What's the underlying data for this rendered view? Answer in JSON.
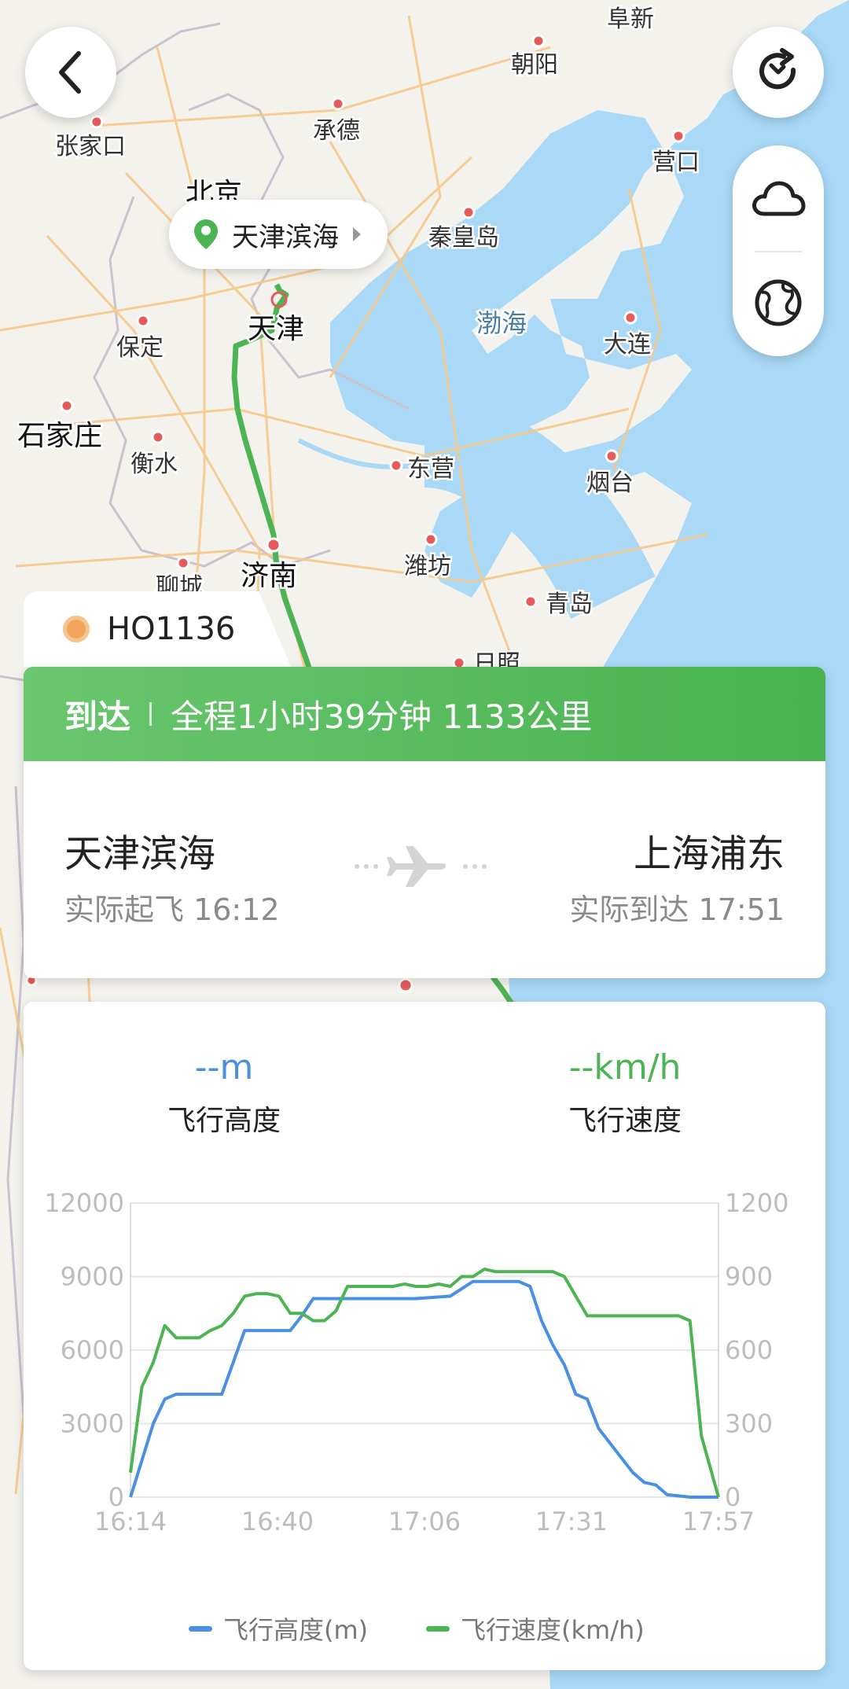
{
  "map": {
    "labels": [
      {
        "name": "阜新",
        "cls": ""
      },
      {
        "name": "朝阳",
        "cls": ""
      },
      {
        "name": "张家口",
        "cls": ""
      },
      {
        "name": "承德",
        "cls": ""
      },
      {
        "name": "营口",
        "cls": ""
      },
      {
        "name": "北京",
        "cls": "big"
      },
      {
        "name": "秦皇岛",
        "cls": ""
      },
      {
        "name": "天津",
        "cls": "big"
      },
      {
        "name": "保定",
        "cls": ""
      },
      {
        "name": "渤海",
        "cls": "sea"
      },
      {
        "name": "大连",
        "cls": ""
      },
      {
        "name": "石家庄",
        "cls": "big"
      },
      {
        "name": "衡水",
        "cls": ""
      },
      {
        "name": "东营",
        "cls": ""
      },
      {
        "name": "烟台",
        "cls": ""
      },
      {
        "name": "济南",
        "cls": "big"
      },
      {
        "name": "潍坊",
        "cls": ""
      },
      {
        "name": "聊城",
        "cls": ""
      },
      {
        "name": "青岛",
        "cls": ""
      },
      {
        "name": "日照",
        "cls": ""
      }
    ],
    "origin_tag": "天津滨海",
    "accent_green": "#4cb453",
    "sea_color": "#a8d8f5"
  },
  "controls": {
    "back_icon": "chevron-left-icon",
    "refresh_icon": "refresh-icon",
    "weather_icon": "cloud-icon",
    "globe_icon": "globe-icon"
  },
  "flight": {
    "number": "HO1136",
    "status": "到达",
    "summary": "全程1小时39分钟 1133公里",
    "origin": {
      "name": "天津滨海",
      "time_label": "实际起飞 16:12"
    },
    "destination": {
      "name": "上海浦东",
      "time_label": "实际到达 17:51"
    }
  },
  "metrics": {
    "altitude_value": "--m",
    "altitude_label": "飞行高度",
    "speed_value": "--km/h",
    "speed_label": "飞行速度",
    "altitude_color": "#4a90e2",
    "speed_color": "#4cb453"
  },
  "legend": {
    "altitude": "飞行高度(m)",
    "speed": "飞行速度(km/h)"
  },
  "chart_data": {
    "type": "line",
    "x_ticks": [
      "16:14",
      "16:40",
      "17:06",
      "17:31",
      "17:57"
    ],
    "y_left": {
      "ticks": [
        "12000",
        "9000",
        "6000",
        "3000",
        "0"
      ],
      "range": [
        0,
        12000
      ]
    },
    "y_right": {
      "ticks": [
        "1200",
        "900",
        "600",
        "300",
        "0"
      ],
      "range": [
        0,
        1200
      ]
    },
    "x_range_minutes": [
      0,
      103
    ],
    "grid": true,
    "legend_position": "bottom",
    "series": [
      {
        "name": "飞行高度(m)",
        "axis": "left",
        "color": "#4a90e2",
        "x": [
          0,
          2,
          4,
          6,
          8,
          10,
          13,
          16,
          20,
          22,
          24,
          26,
          28,
          30,
          32,
          34,
          35,
          37,
          38,
          40,
          42,
          44,
          46,
          50,
          56,
          60,
          62,
          64,
          66,
          68,
          70,
          72,
          74,
          76,
          78,
          80,
          82,
          84,
          86,
          88,
          90,
          92,
          94,
          96,
          98,
          100,
          103
        ],
        "y": [
          0,
          1500,
          3000,
          4000,
          4200,
          4200,
          4200,
          4200,
          6800,
          6800,
          6800,
          6800,
          6800,
          7400,
          8100,
          8100,
          8100,
          8100,
          8100,
          8100,
          8100,
          8100,
          8100,
          8100,
          8200,
          8800,
          8800,
          8800,
          8800,
          8800,
          8600,
          7200,
          6200,
          5400,
          4200,
          4000,
          2800,
          2200,
          1600,
          1000,
          600,
          500,
          100,
          50,
          0,
          0,
          0
        ]
      },
      {
        "name": "飞行速度(km/h)",
        "axis": "right",
        "color": "#4cb453",
        "x": [
          0,
          2,
          4,
          6,
          8,
          10,
          12,
          14,
          16,
          18,
          20,
          22,
          24,
          26,
          28,
          30,
          32,
          34,
          36,
          38,
          40,
          42,
          44,
          46,
          48,
          50,
          52,
          54,
          56,
          58,
          60,
          62,
          64,
          66,
          68,
          70,
          72,
          74,
          76,
          80,
          86,
          90,
          92,
          94,
          96,
          98,
          100,
          103
        ],
        "y": [
          100,
          450,
          550,
          700,
          650,
          650,
          650,
          680,
          700,
          750,
          820,
          830,
          830,
          820,
          750,
          750,
          720,
          720,
          760,
          860,
          860,
          860,
          860,
          860,
          870,
          860,
          860,
          870,
          860,
          900,
          900,
          930,
          920,
          920,
          920,
          920,
          920,
          920,
          900,
          740,
          740,
          740,
          740,
          740,
          740,
          720,
          250,
          0
        ]
      }
    ]
  }
}
